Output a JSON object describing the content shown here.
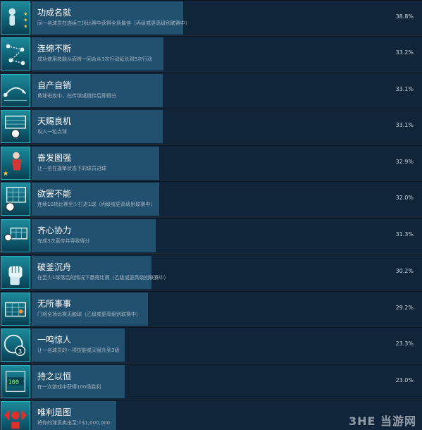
{
  "achievements": [
    {
      "title": "功成名就",
      "desc": "同一名球员在连续三场比赛中获得全场最佳（丙级或更高级别联赛中）",
      "percent": "38.8%",
      "icon": "medal-player-icon"
    },
    {
      "title": "连绵不断",
      "desc": "成功使用技能从而将一回合从3次行动延长到5次行动",
      "percent": "33.2%",
      "icon": "tactics-chain-icon"
    },
    {
      "title": "自产自销",
      "desc": "角球进攻中，在传球或跳传后即得分",
      "percent": "33.1%",
      "icon": "pass-arrow-icon"
    },
    {
      "title": "天赐良机",
      "desc": "攻入一粒点球",
      "percent": "33.1%",
      "icon": "penalty-goal-icon"
    },
    {
      "title": "奋发图强",
      "desc": "让一名在逼擎状态下的球员进球",
      "percent": "32.9%",
      "icon": "striker-star-icon"
    },
    {
      "title": "欲罢不能",
      "desc": "连续10场比赛至少打进1球（丙级或更高级别联赛中）",
      "percent": "32.0%",
      "icon": "ball-net-icon"
    },
    {
      "title": "齐心协力",
      "desc": "完成3次直传并导致得分",
      "percent": "31.3%",
      "icon": "goal-assist-icon"
    },
    {
      "title": "破釜沉舟",
      "desc": "在至少1球落后的情况下赢得比赛（乙级或更高级别联赛中）",
      "percent": "30.2%",
      "icon": "fist-icon"
    },
    {
      "title": "无所事事",
      "desc": "门将全场比赛无触球（乙级或更高级别联赛中）",
      "percent": "29.2%",
      "icon": "empty-goal-icon"
    },
    {
      "title": "一鸣惊人",
      "desc": "让一名球员的一项技能或天赋升到3级",
      "percent": "23.3%",
      "icon": "level-three-icon"
    },
    {
      "title": "持之以恒",
      "desc": "在一次游戏中获得100场胜利",
      "percent": "23.0%",
      "icon": "hundred-wins-icon"
    },
    {
      "title": "唯利是图",
      "desc": "将你的球员卖出至少$1,000,000",
      "percent": "",
      "icon": "money-transfer-icon"
    }
  ],
  "watermark": "3HE 当游网",
  "colors": {
    "background": "#1b2838",
    "bar": "#22506f",
    "icon_border": "#2bb3c0"
  }
}
